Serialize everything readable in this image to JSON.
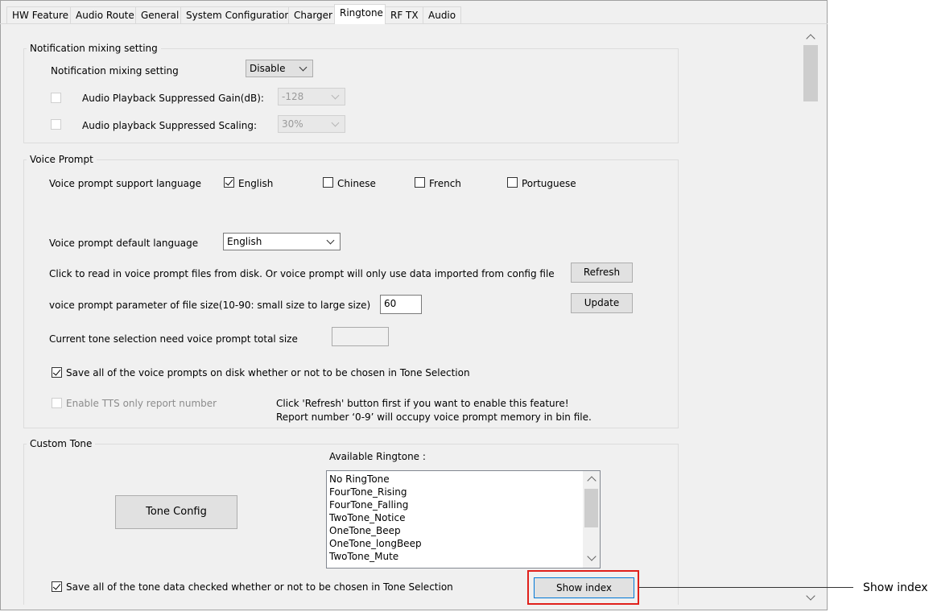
{
  "tabs": [
    {
      "label": "HW Feature"
    },
    {
      "label": "Audio Route"
    },
    {
      "label": "General"
    },
    {
      "label": "System Configuration"
    },
    {
      "label": "Charger"
    },
    {
      "label": "Ringtone",
      "active": true
    },
    {
      "label": "RF TX"
    },
    {
      "label": "Audio"
    }
  ],
  "notification": {
    "group_title": "Notification mixing setting",
    "mixing_label": "Notification mixing setting",
    "mixing_value": "Disable",
    "gain_label": "Audio Playback Suppressed Gain(dB):",
    "gain_value": "-128",
    "scaling_label": "Audio playback Suppressed Scaling:",
    "scaling_value": "30%"
  },
  "voice_prompt": {
    "group_title": "Voice Prompt",
    "support_language_label": "Voice prompt support language",
    "languages": [
      {
        "label": "English",
        "checked": true
      },
      {
        "label": "Chinese",
        "checked": false
      },
      {
        "label": "French",
        "checked": false
      },
      {
        "label": "Portuguese",
        "checked": false
      }
    ],
    "default_language_label": "Voice prompt default language",
    "default_language_value": "English",
    "read_files_text": "Click to read in voice prompt files  from disk. Or voice prompt will only use data imported from config file",
    "refresh_label": "Refresh",
    "file_size_label": "voice prompt parameter of file size(10-90: small size to large size)",
    "file_size_value": "60",
    "update_label": "Update",
    "total_size_label": "Current tone selection need voice prompt total size",
    "total_size_value": "",
    "save_all_label": "Save all of the voice prompts on disk whether or not to be chosen in Tone Selection",
    "tts_label": "Enable TTS only report number",
    "tts_note_1": "Click 'Refresh' button first if you want to enable this feature!",
    "tts_note_2": "Report number ‘0-9’ will occupy voice prompt  memory in bin file."
  },
  "custom_tone": {
    "group_title": "Custom Tone",
    "available_label": "Available Ringtone :",
    "ringtones": [
      "No RingTone",
      "FourTone_Rising",
      "FourTone_Falling",
      "TwoTone_Notice",
      "OneTone_Beep",
      "OneTone_longBeep",
      "TwoTone_Mute"
    ],
    "tone_config_label": "Tone Config",
    "save_tone_label": "Save all of the tone data checked whether or not to be chosen in Tone Selection",
    "show_index_label": "Show index"
  },
  "annotation": {
    "callout_label": "Show index",
    "highlight_color": "#e0201b"
  }
}
